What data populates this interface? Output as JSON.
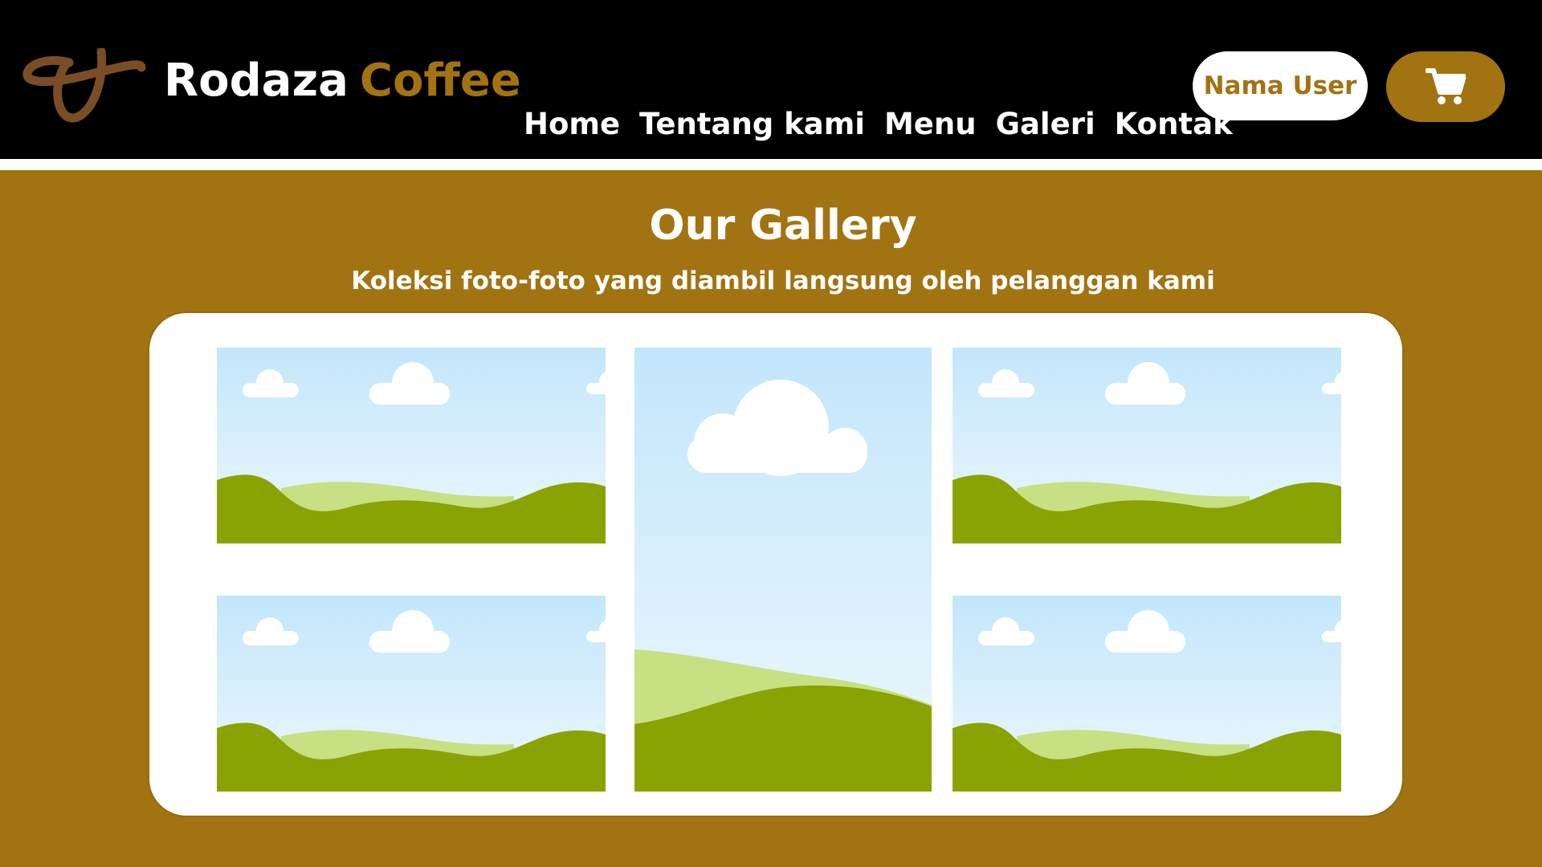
{
  "brand": {
    "name_part_1": "Rodaza",
    "name_part_2": "Coffee",
    "logo_icon": "coffee-bean-swirl-logo"
  },
  "nav": {
    "items": [
      {
        "label": "Home"
      },
      {
        "label": "Tentang kami"
      },
      {
        "label": "Menu"
      },
      {
        "label": "Galeri"
      },
      {
        "label": "Kontak"
      }
    ]
  },
  "header": {
    "user_label": "Nama User",
    "cart_icon": "shopping-cart-icon"
  },
  "gallery": {
    "title": "Our Gallery",
    "subtitle": "Koleksi foto-foto yang diambil langsung oleh pelanggan kami",
    "image_icon": "landscape-placeholder-icon"
  },
  "colors": {
    "background": "#a27311",
    "navbar": "#000000",
    "accent": "#a27311",
    "logo": "#7a4e25",
    "sky_top": "#c3e6fb",
    "sky_bottom": "#eef8fd",
    "hill_dark": "#8aa304",
    "hill_light": "#c6e083"
  }
}
